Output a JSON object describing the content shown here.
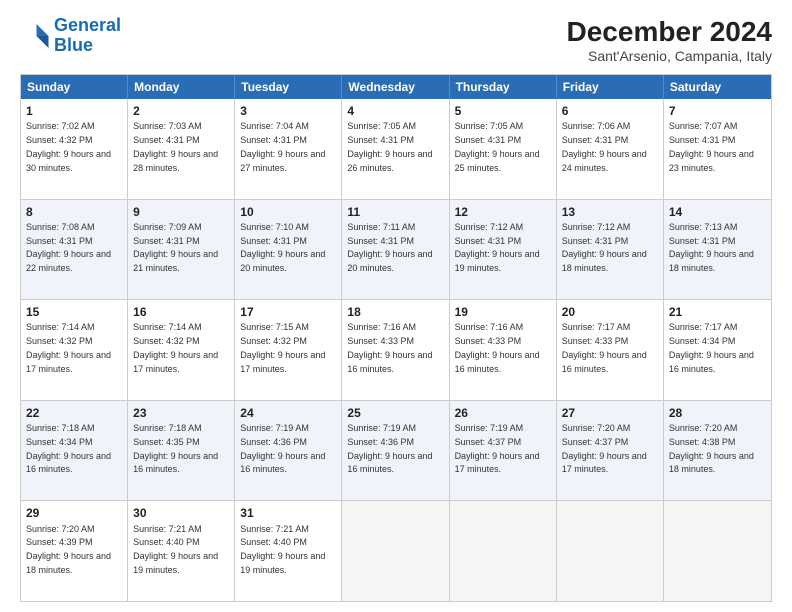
{
  "header": {
    "logo_line1": "General",
    "logo_line2": "Blue",
    "month_title": "December 2024",
    "location": "Sant'Arsenio, Campania, Italy"
  },
  "weekdays": [
    "Sunday",
    "Monday",
    "Tuesday",
    "Wednesday",
    "Thursday",
    "Friday",
    "Saturday"
  ],
  "weeks": [
    [
      {
        "day": "1",
        "sunrise": "7:02 AM",
        "sunset": "4:32 PM",
        "daylight": "9 hours and 30 minutes."
      },
      {
        "day": "2",
        "sunrise": "7:03 AM",
        "sunset": "4:31 PM",
        "daylight": "9 hours and 28 minutes."
      },
      {
        "day": "3",
        "sunrise": "7:04 AM",
        "sunset": "4:31 PM",
        "daylight": "9 hours and 27 minutes."
      },
      {
        "day": "4",
        "sunrise": "7:05 AM",
        "sunset": "4:31 PM",
        "daylight": "9 hours and 26 minutes."
      },
      {
        "day": "5",
        "sunrise": "7:05 AM",
        "sunset": "4:31 PM",
        "daylight": "9 hours and 25 minutes."
      },
      {
        "day": "6",
        "sunrise": "7:06 AM",
        "sunset": "4:31 PM",
        "daylight": "9 hours and 24 minutes."
      },
      {
        "day": "7",
        "sunrise": "7:07 AM",
        "sunset": "4:31 PM",
        "daylight": "9 hours and 23 minutes."
      }
    ],
    [
      {
        "day": "8",
        "sunrise": "7:08 AM",
        "sunset": "4:31 PM",
        "daylight": "9 hours and 22 minutes."
      },
      {
        "day": "9",
        "sunrise": "7:09 AM",
        "sunset": "4:31 PM",
        "daylight": "9 hours and 21 minutes."
      },
      {
        "day": "10",
        "sunrise": "7:10 AM",
        "sunset": "4:31 PM",
        "daylight": "9 hours and 20 minutes."
      },
      {
        "day": "11",
        "sunrise": "7:11 AM",
        "sunset": "4:31 PM",
        "daylight": "9 hours and 20 minutes."
      },
      {
        "day": "12",
        "sunrise": "7:12 AM",
        "sunset": "4:31 PM",
        "daylight": "9 hours and 19 minutes."
      },
      {
        "day": "13",
        "sunrise": "7:12 AM",
        "sunset": "4:31 PM",
        "daylight": "9 hours and 18 minutes."
      },
      {
        "day": "14",
        "sunrise": "7:13 AM",
        "sunset": "4:31 PM",
        "daylight": "9 hours and 18 minutes."
      }
    ],
    [
      {
        "day": "15",
        "sunrise": "7:14 AM",
        "sunset": "4:32 PM",
        "daylight": "9 hours and 17 minutes."
      },
      {
        "day": "16",
        "sunrise": "7:14 AM",
        "sunset": "4:32 PM",
        "daylight": "9 hours and 17 minutes."
      },
      {
        "day": "17",
        "sunrise": "7:15 AM",
        "sunset": "4:32 PM",
        "daylight": "9 hours and 17 minutes."
      },
      {
        "day": "18",
        "sunrise": "7:16 AM",
        "sunset": "4:33 PM",
        "daylight": "9 hours and 16 minutes."
      },
      {
        "day": "19",
        "sunrise": "7:16 AM",
        "sunset": "4:33 PM",
        "daylight": "9 hours and 16 minutes."
      },
      {
        "day": "20",
        "sunrise": "7:17 AM",
        "sunset": "4:33 PM",
        "daylight": "9 hours and 16 minutes."
      },
      {
        "day": "21",
        "sunrise": "7:17 AM",
        "sunset": "4:34 PM",
        "daylight": "9 hours and 16 minutes."
      }
    ],
    [
      {
        "day": "22",
        "sunrise": "7:18 AM",
        "sunset": "4:34 PM",
        "daylight": "9 hours and 16 minutes."
      },
      {
        "day": "23",
        "sunrise": "7:18 AM",
        "sunset": "4:35 PM",
        "daylight": "9 hours and 16 minutes."
      },
      {
        "day": "24",
        "sunrise": "7:19 AM",
        "sunset": "4:36 PM",
        "daylight": "9 hours and 16 minutes."
      },
      {
        "day": "25",
        "sunrise": "7:19 AM",
        "sunset": "4:36 PM",
        "daylight": "9 hours and 16 minutes."
      },
      {
        "day": "26",
        "sunrise": "7:19 AM",
        "sunset": "4:37 PM",
        "daylight": "9 hours and 17 minutes."
      },
      {
        "day": "27",
        "sunrise": "7:20 AM",
        "sunset": "4:37 PM",
        "daylight": "9 hours and 17 minutes."
      },
      {
        "day": "28",
        "sunrise": "7:20 AM",
        "sunset": "4:38 PM",
        "daylight": "9 hours and 18 minutes."
      }
    ],
    [
      {
        "day": "29",
        "sunrise": "7:20 AM",
        "sunset": "4:39 PM",
        "daylight": "9 hours and 18 minutes."
      },
      {
        "day": "30",
        "sunrise": "7:21 AM",
        "sunset": "4:40 PM",
        "daylight": "9 hours and 19 minutes."
      },
      {
        "day": "31",
        "sunrise": "7:21 AM",
        "sunset": "4:40 PM",
        "daylight": "9 hours and 19 minutes."
      },
      null,
      null,
      null,
      null
    ]
  ]
}
